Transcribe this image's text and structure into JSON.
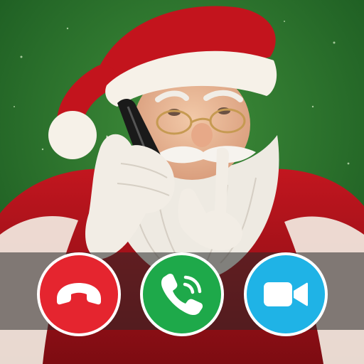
{
  "call_controls": {
    "decline": {
      "icon": "phone-hangup-icon",
      "color": "#e5252f"
    },
    "accept": {
      "icon": "phone-ringing-icon",
      "color": "#1ea94a"
    },
    "video": {
      "icon": "video-camera-icon",
      "color": "#1fb3e6"
    }
  },
  "caller_photo": {
    "subject": "santa-claus-on-phone",
    "background_color": "#2b7a2f",
    "suit_color": "#b3131b"
  }
}
